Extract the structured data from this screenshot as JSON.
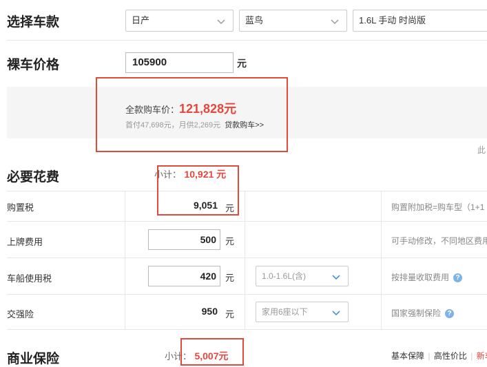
{
  "select_car": {
    "heading": "选择车款",
    "brand": "日产",
    "series": "蓝鸟",
    "model": "1.6L 手动 时尚版"
  },
  "bare_price": {
    "heading": "裸车价格",
    "value": "105900",
    "unit": "元"
  },
  "summary": {
    "total_label": "全款购车价：",
    "total_value": "121,828元",
    "loan_text": "首付47,698元，月供2,269元",
    "loan_link": "贷款购车>>",
    "right_fragment": "此"
  },
  "necessary": {
    "heading": "必要花费",
    "subtotal_label": "小计：",
    "subtotal_value": "10,921 元",
    "rows": [
      {
        "label": "购置税",
        "value": "9,051",
        "unit": "元",
        "note": "购置附加税=购车型（1+1"
      },
      {
        "label": "上牌费用",
        "value": "500",
        "unit": "元",
        "note": "可手动修改，不同地区费用"
      },
      {
        "label": "车船使用税",
        "value": "420",
        "unit": "元",
        "option": "1.0-1.6L(含)",
        "note": "按排量收取费用"
      },
      {
        "label": "交强险",
        "value": "950",
        "unit": "元",
        "option": "家用6座以下",
        "note": "国家强制保险"
      }
    ]
  },
  "commercial": {
    "heading": "商业保险",
    "subtotal_label": "小计：",
    "subtotal_value": "5,007元",
    "plans": [
      "基本保障",
      "高性价比",
      "新车"
    ],
    "separator": "|"
  },
  "colors": {
    "accent_red": "#e8453c",
    "box_red": "#e04a3a",
    "help_blue": "#7fb2e5"
  },
  "icons": {
    "dropdown": "chevron-down-icon",
    "help": "question-circle-icon"
  }
}
